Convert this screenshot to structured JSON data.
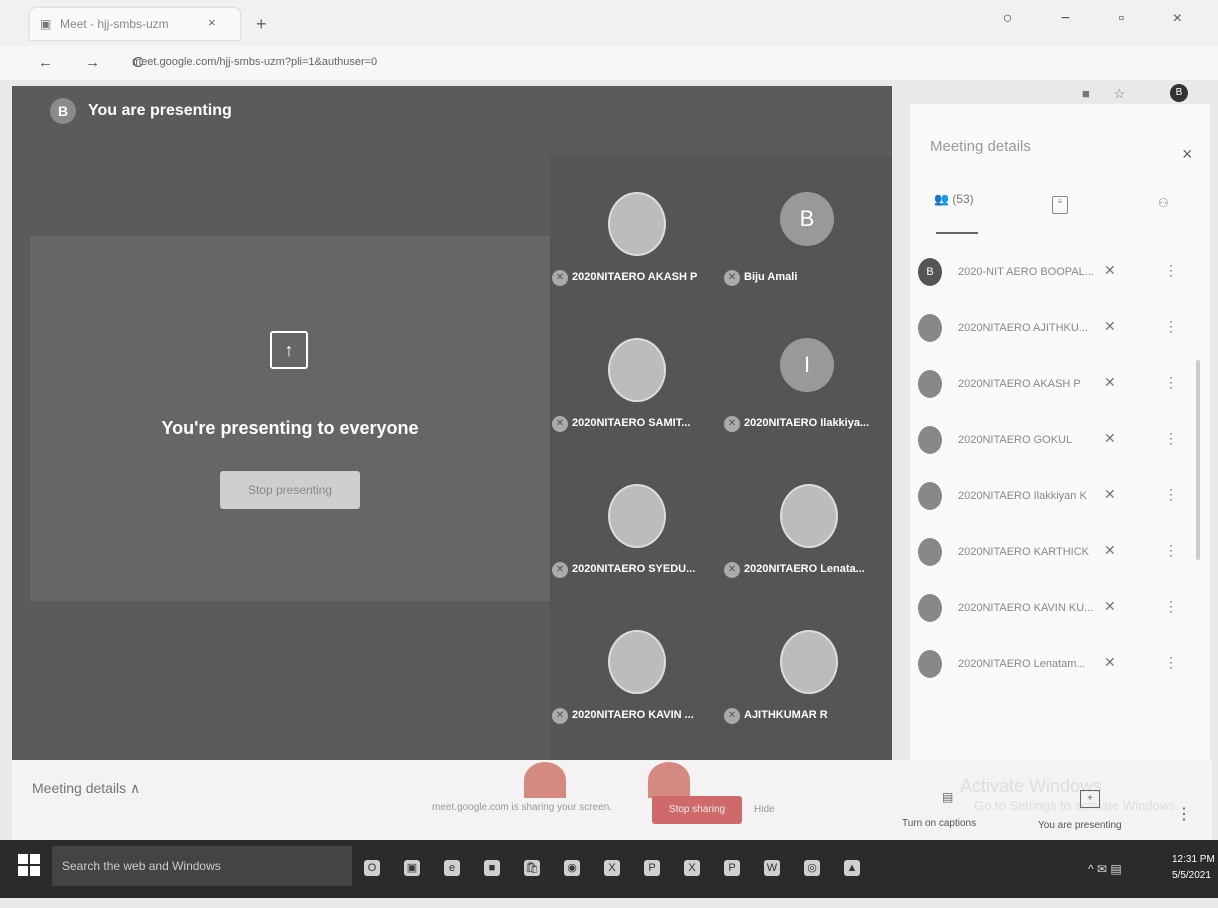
{
  "browser": {
    "tab_title": "Meet - hjj-smbs-uzm",
    "tab_close": "×",
    "new_tab": "+",
    "url": "meet.google.com/hjj-smbs-uzm?pli=1&authuser=0",
    "nav": "← → C",
    "extensions": "■ ☆",
    "profile_initial": "B",
    "window_controls": "○ − ▫ ×"
  },
  "stage": {
    "presenter_initial": "B",
    "title": "You are presenting",
    "present_icon": "↑",
    "present_message": "You're presenting to everyone",
    "stop_presenting": "Stop presenting",
    "tiles": [
      {
        "name": "2020NITAERO AKASH P",
        "avatar": ""
      },
      {
        "name": "Biju Amali",
        "avatar": "B"
      },
      {
        "name": "2020NITAERO SAMIT...",
        "avatar": ""
      },
      {
        "name": "2020NITAERO Ilakkiya...",
        "avatar": "I"
      },
      {
        "name": "2020NITAERO SYEDU...",
        "avatar": ""
      },
      {
        "name": "2020NITAERO Lenata...",
        "avatar": ""
      },
      {
        "name": "2020NITAERO KAVIN ...",
        "avatar": ""
      },
      {
        "name": "AJITHKUMAR R",
        "avatar": ""
      }
    ]
  },
  "bottom": {
    "meeting_details": "Meeting details ∧",
    "share_banner": "meet.google.com is sharing your screen.",
    "stop_sharing": "Stop sharing",
    "hide": "Hide",
    "activate_title": "Activate Windows",
    "activate_sub": "Go to Settings to activate Windows.",
    "captions_label": "Turn on captions",
    "present_label": "You are presenting",
    "more": "⋮"
  },
  "panel": {
    "title": "Meeting details",
    "close": "×",
    "people_tab": "(53)",
    "participants": [
      {
        "name": "2020-NIT AERO BOOPAL...",
        "avatar": "B"
      },
      {
        "name": "2020NITAERO AJITHKU...",
        "avatar": ""
      },
      {
        "name": "2020NITAERO AKASH P",
        "avatar": ""
      },
      {
        "name": "2020NITAERO GOKUL",
        "avatar": ""
      },
      {
        "name": "2020NITAERO Ilakkiyan K",
        "avatar": ""
      },
      {
        "name": "2020NITAERO KARTHICK",
        "avatar": ""
      },
      {
        "name": "2020NITAERO KAVIN KU...",
        "avatar": ""
      },
      {
        "name": "2020NITAERO Lenatam...",
        "avatar": ""
      }
    ]
  },
  "taskbar": {
    "search": "Search the web and Windows",
    "icons": [
      "O",
      "▣",
      "e",
      "■",
      "🛍",
      "◉",
      "X",
      "P",
      "X",
      "P",
      "W",
      "◎",
      "▲"
    ],
    "tray": "^ ✉ ▤",
    "time": "12:31 PM",
    "date": "5/5/2021"
  }
}
